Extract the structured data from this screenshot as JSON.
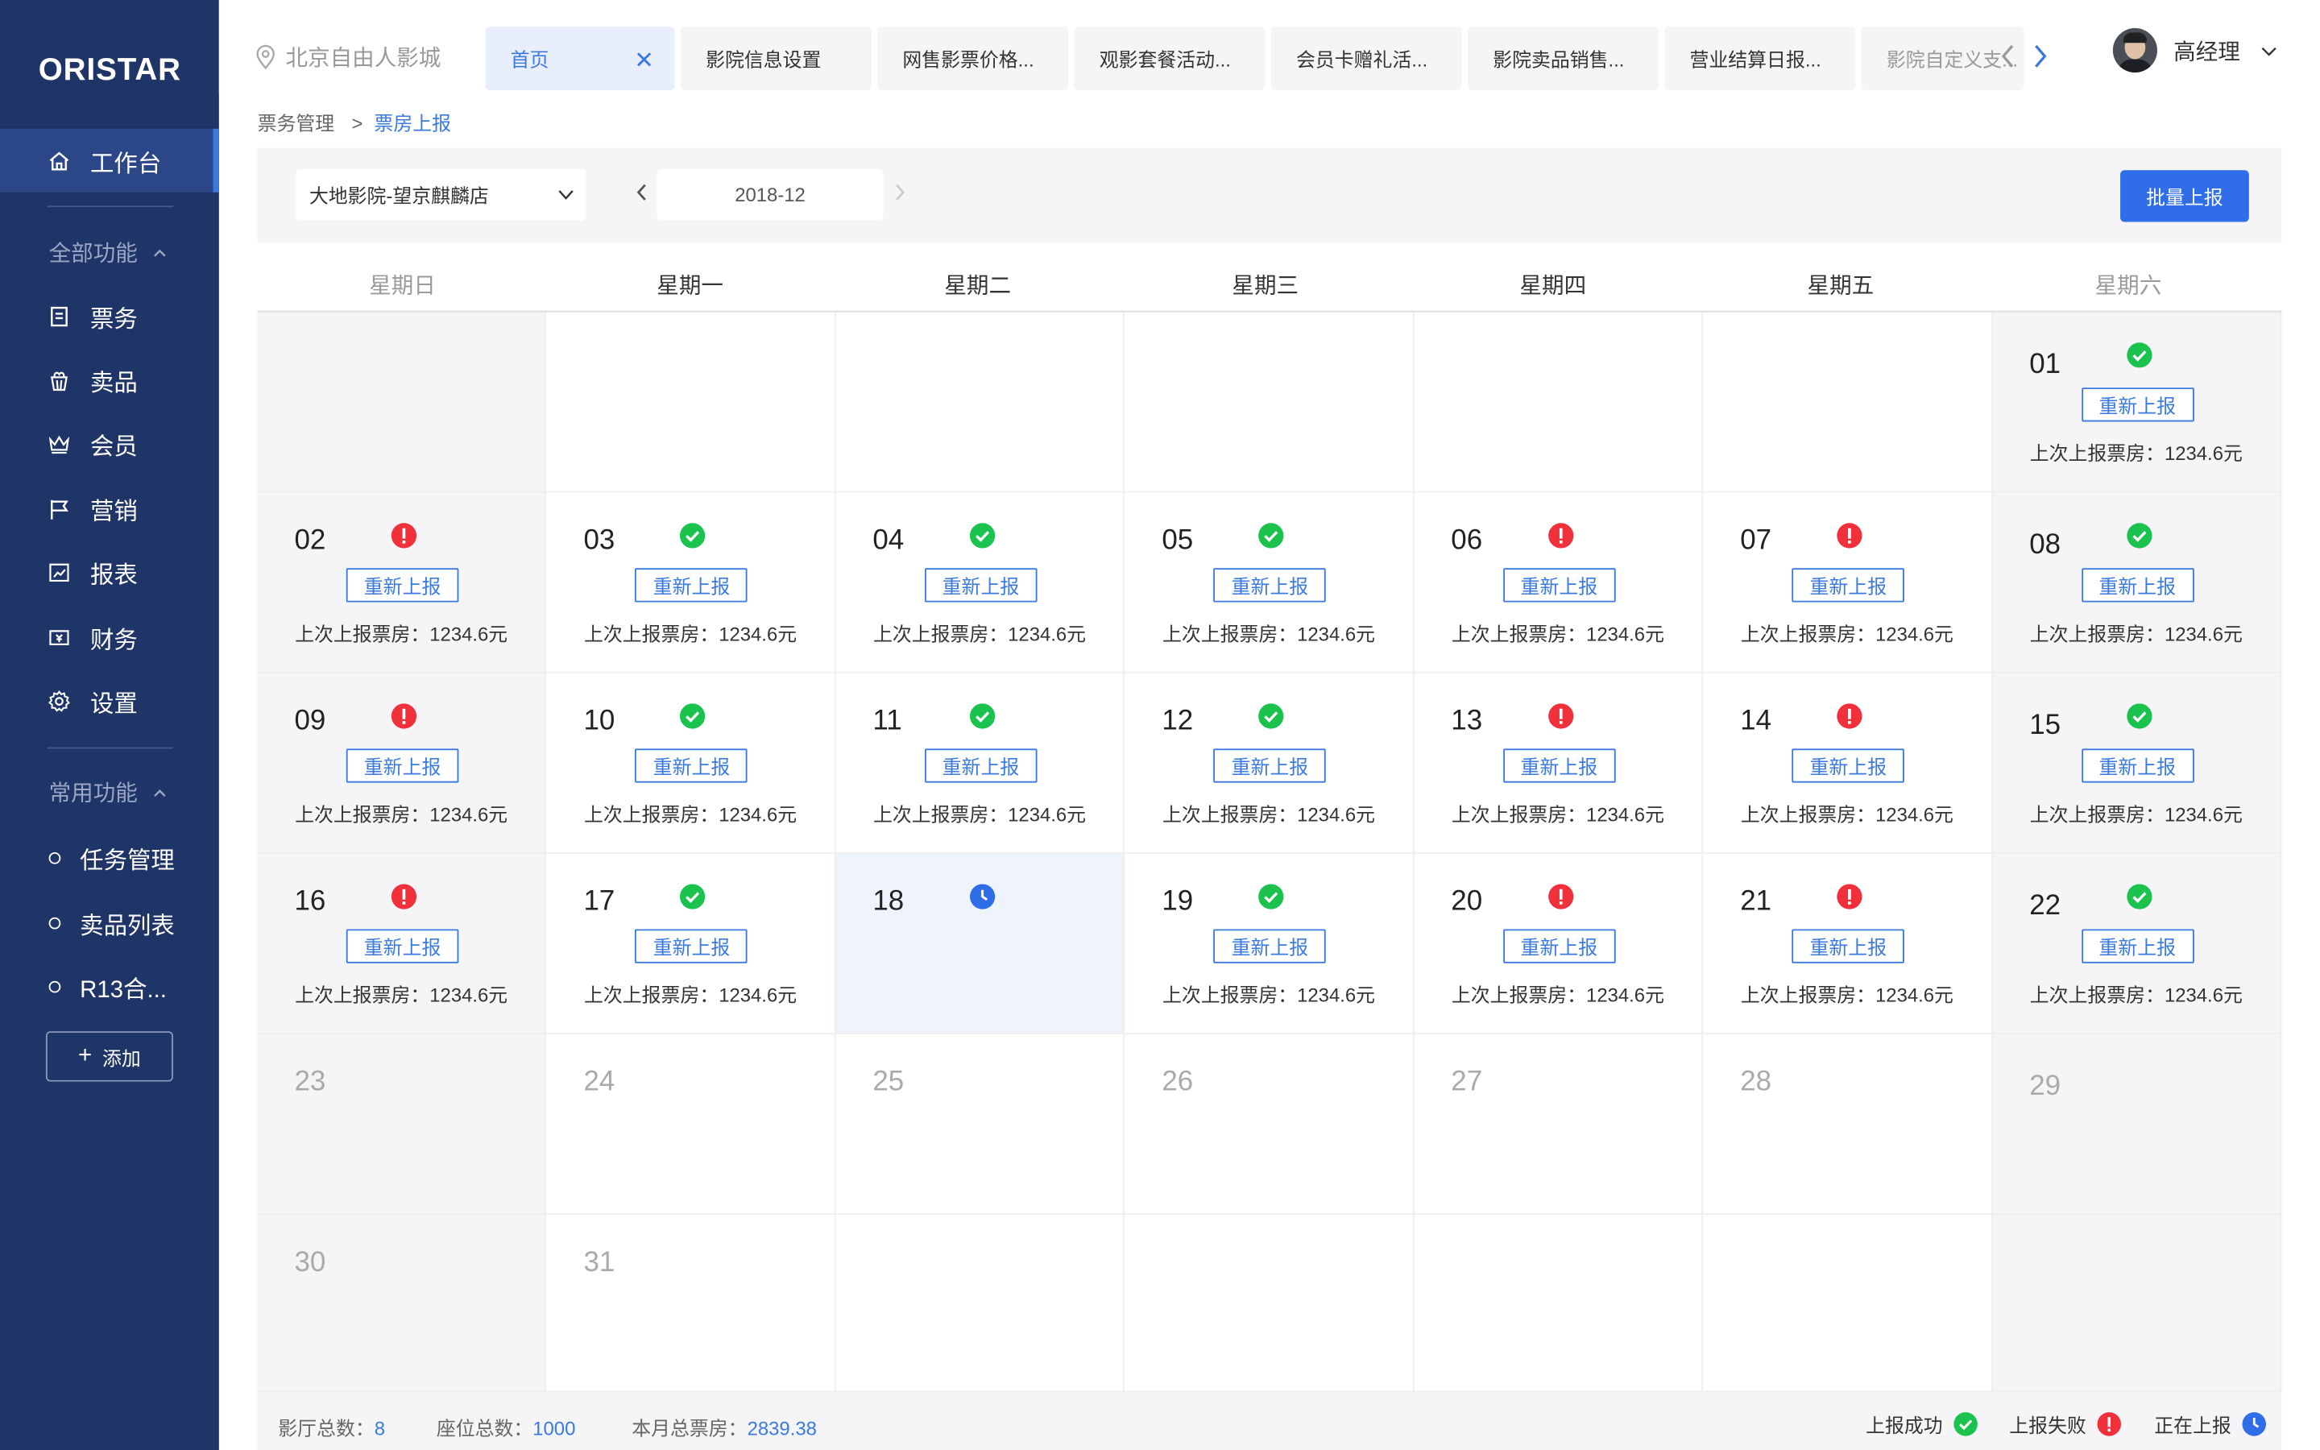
{
  "app": {
    "logo": "ORISTAR"
  },
  "sidebar": {
    "workbench": "工作台",
    "group_all": "全部功能",
    "items": [
      {
        "label": "票务",
        "icon": "ticket-icon"
      },
      {
        "label": "卖品",
        "icon": "popcorn-icon"
      },
      {
        "label": "会员",
        "icon": "crown-icon"
      },
      {
        "label": "营销",
        "icon": "flag-icon"
      },
      {
        "label": "报表",
        "icon": "chart-icon"
      },
      {
        "label": "财务",
        "icon": "money-icon"
      },
      {
        "label": "设置",
        "icon": "gear-icon"
      }
    ],
    "group_common": "常用功能",
    "common": [
      {
        "label": "任务管理"
      },
      {
        "label": "卖品列表"
      },
      {
        "label": "R13合..."
      }
    ],
    "add_label": "添加"
  },
  "topbar": {
    "location": "北京自由人影城",
    "tabs": [
      {
        "label": "首页",
        "active": true
      },
      {
        "label": "影院信息设置"
      },
      {
        "label": "网售影票价格..."
      },
      {
        "label": "观影套餐活动..."
      },
      {
        "label": "会员卡赠礼活..."
      },
      {
        "label": "影院卖品销售..."
      },
      {
        "label": "营业结算日报..."
      },
      {
        "label": "影院自定义支..."
      }
    ],
    "user": "高经理"
  },
  "breadcrumb": {
    "parent": "票务管理",
    "sep": ">",
    "current": "票房上报"
  },
  "filter": {
    "cinema": "大地影院-望京麒麟店",
    "month": "2018-12",
    "batch_button": "批量上报"
  },
  "weekdays": [
    "星期日",
    "星期一",
    "星期二",
    "星期三",
    "星期四",
    "星期五",
    "星期六"
  ],
  "calendar": {
    "reupload_label": "重新上报",
    "last_label": "上次上报票房：1234.6元",
    "days": [
      {
        "day": "01",
        "status": "success"
      },
      {
        "day": "02",
        "status": "fail"
      },
      {
        "day": "03",
        "status": "success"
      },
      {
        "day": "04",
        "status": "success"
      },
      {
        "day": "05",
        "status": "success"
      },
      {
        "day": "06",
        "status": "fail"
      },
      {
        "day": "07",
        "status": "fail"
      },
      {
        "day": "08",
        "status": "success"
      },
      {
        "day": "09",
        "status": "fail"
      },
      {
        "day": "10",
        "status": "success"
      },
      {
        "day": "11",
        "status": "success"
      },
      {
        "day": "12",
        "status": "success"
      },
      {
        "day": "13",
        "status": "fail"
      },
      {
        "day": "14",
        "status": "fail"
      },
      {
        "day": "15",
        "status": "success"
      },
      {
        "day": "16",
        "status": "fail"
      },
      {
        "day": "17",
        "status": "success"
      },
      {
        "day": "18",
        "status": "pending"
      },
      {
        "day": "19",
        "status": "success"
      },
      {
        "day": "20",
        "status": "fail"
      },
      {
        "day": "21",
        "status": "fail"
      },
      {
        "day": "22",
        "status": "success"
      },
      {
        "day": "23",
        "status": "future"
      },
      {
        "day": "24",
        "status": "future"
      },
      {
        "day": "25",
        "status": "future"
      },
      {
        "day": "26",
        "status": "future"
      },
      {
        "day": "27",
        "status": "future"
      },
      {
        "day": "28",
        "status": "future"
      },
      {
        "day": "29",
        "status": "future"
      },
      {
        "day": "30",
        "status": "future"
      },
      {
        "day": "31",
        "status": "future"
      }
    ]
  },
  "footer": {
    "halls_label": "影厅总数：",
    "halls": "8",
    "seats_label": "座位总数：",
    "seats": "1000",
    "box_label": "本月总票房：",
    "box": "2839.38",
    "legend": {
      "success": "上报成功",
      "fail": "上报失败",
      "pending": "正在上报"
    }
  },
  "colors": {
    "sidebar": "#1f3467",
    "accent": "#3a7ae0",
    "success": "#1bc24e",
    "fail": "#f0303a",
    "pending": "#2f6ee8"
  }
}
